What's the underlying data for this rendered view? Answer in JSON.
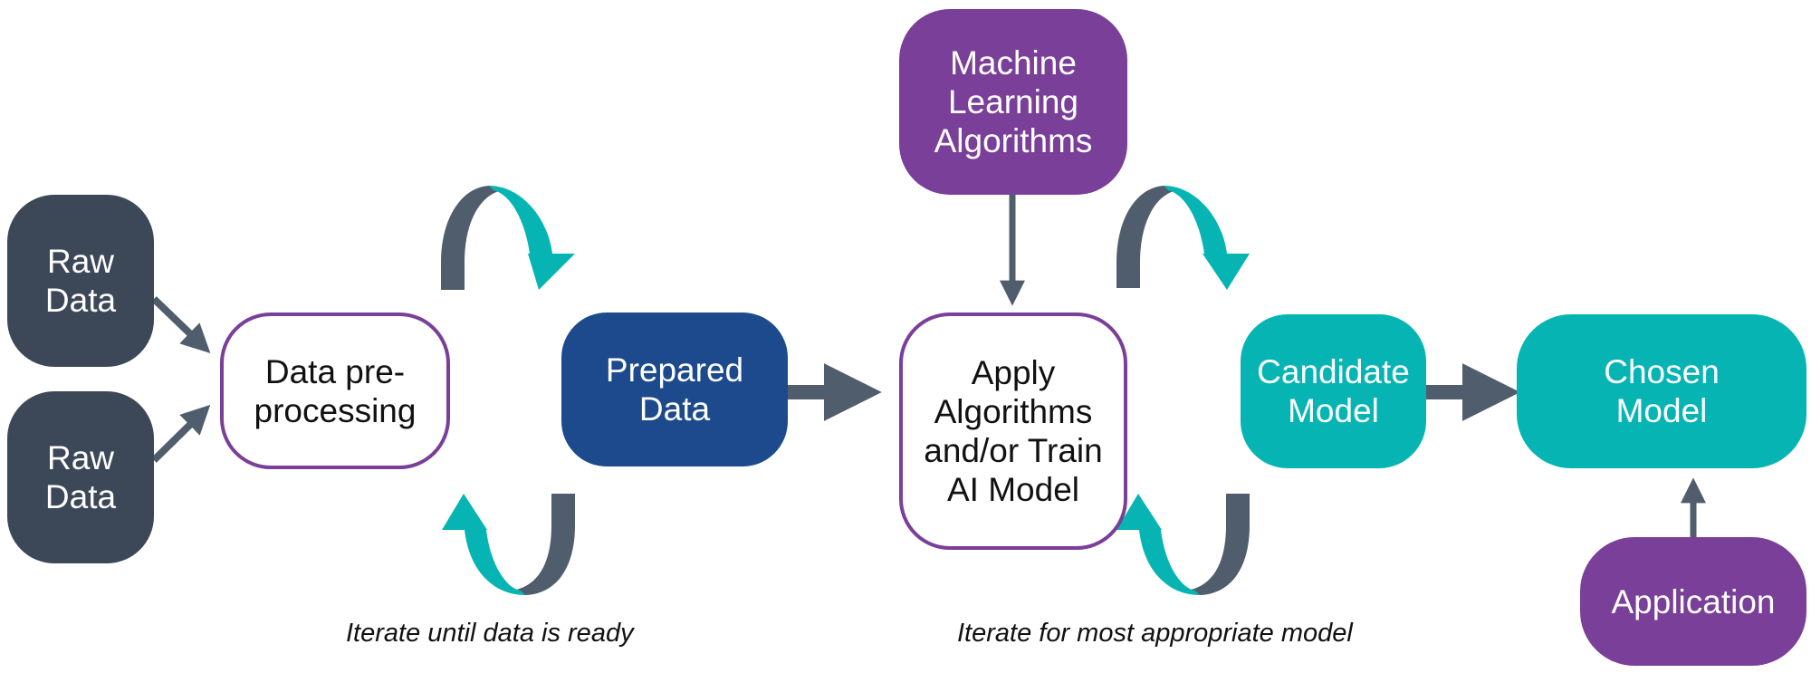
{
  "nodes": {
    "raw_data_1": "Raw\nData",
    "raw_data_2": "Raw\nData",
    "preprocessing": "Data pre-\nprocessing",
    "prepared_data": "Prepared\nData",
    "ml_algorithms": "Machine\nLearning\nAlgorithms",
    "apply_train": "Apply\nAlgorithms\nand/or Train\nAI Model",
    "candidate_model": "Candidate\nModel",
    "chosen_model": "Chosen\nModel",
    "application": "Application"
  },
  "captions": {
    "iterate_data": "Iterate until data is ready",
    "iterate_model": "Iterate for most appropriate model"
  },
  "colors": {
    "dark": "#3c4858",
    "arrow": "#505d6c",
    "teal": "#06b5b3",
    "purple": "#7a3f98",
    "navy": "#1d4a8c"
  }
}
